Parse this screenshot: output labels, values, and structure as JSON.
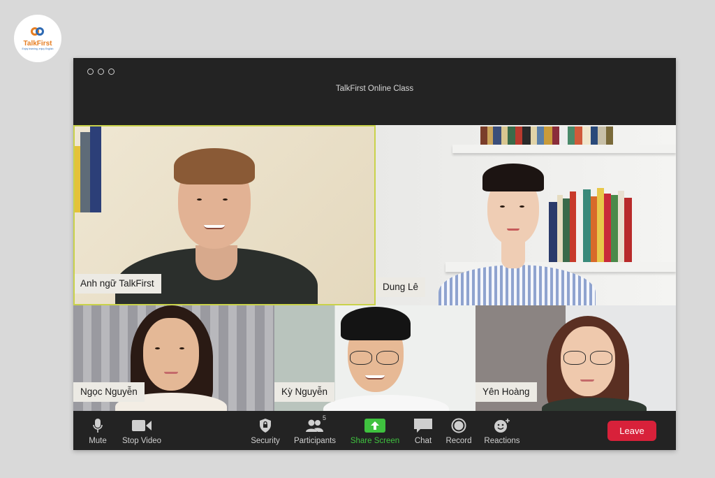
{
  "logo": {
    "brand": "TalkFirst",
    "tagline": "Enjoy learning, enjoy English"
  },
  "window": {
    "title": "TalkFirst Online Class"
  },
  "participants": [
    {
      "name": "Anh ngữ TalkFirst",
      "active": true
    },
    {
      "name": "Dung Lê"
    },
    {
      "name": "Ngọc Nguyễn"
    },
    {
      "name": "Kỳ Nguyễn"
    },
    {
      "name": "Yên Hoàng"
    }
  ],
  "toolbar": {
    "mute": "Mute",
    "stop_video": "Stop Video",
    "security": "Security",
    "participants": "Participants",
    "participants_count": "5",
    "share_screen": "Share Screen",
    "chat": "Chat",
    "record": "Record",
    "reactions": "Reactions",
    "leave": "Leave"
  },
  "colors": {
    "accent_green": "#3fc23f",
    "leave_red": "#d8213a",
    "active_speaker_border": "#c9d24a"
  }
}
